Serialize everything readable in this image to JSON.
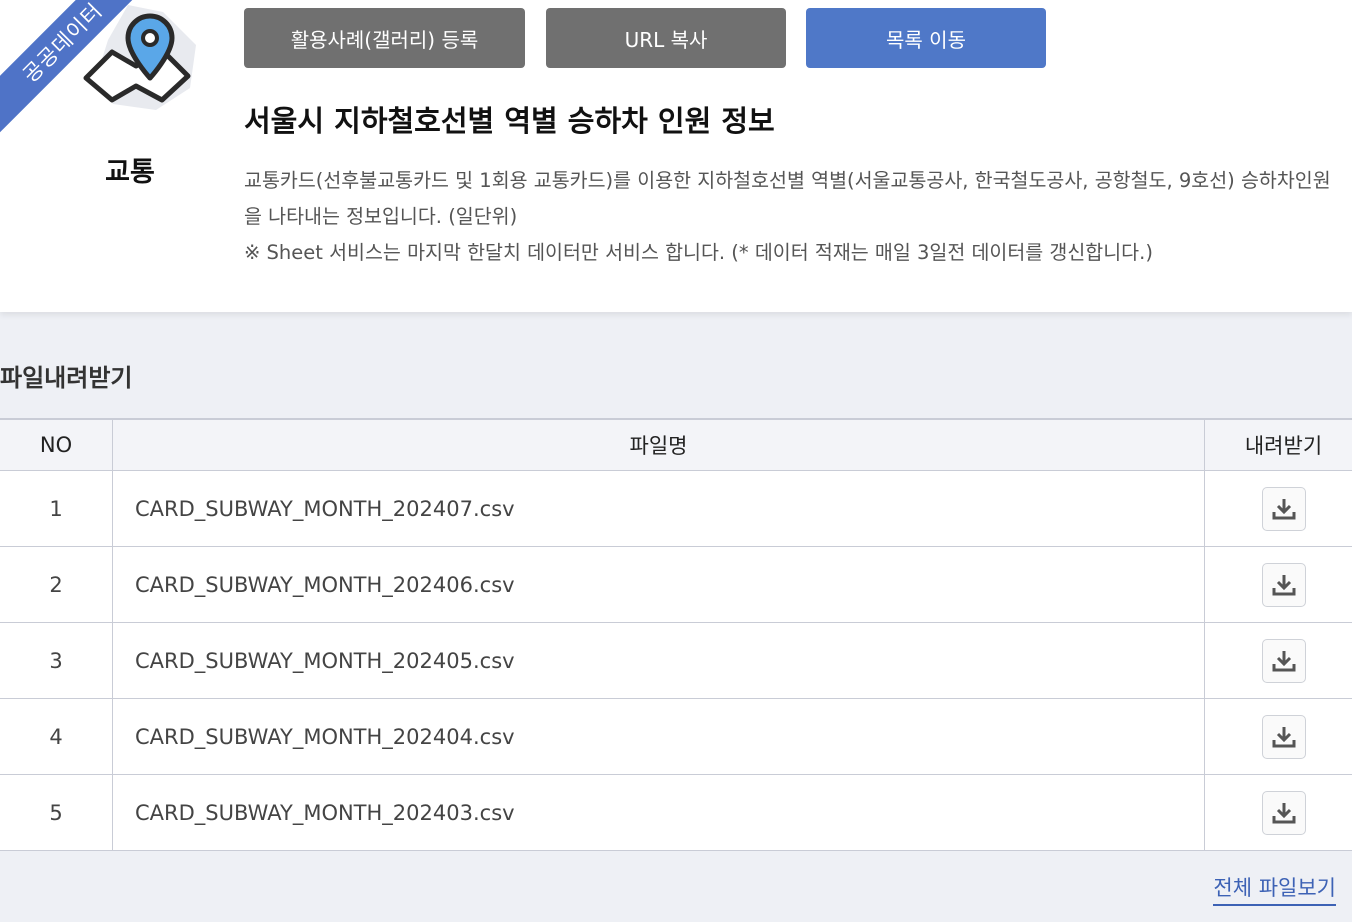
{
  "category": {
    "ribbon_text": "공공데이터",
    "label": "교통",
    "icon": "map-pin-icon"
  },
  "buttons": {
    "gallery": "활용사례(갤러리) 등록",
    "copy_url": "URL 복사",
    "list": "목록 이동"
  },
  "dataset": {
    "title": "서울시 지하철호선별 역별 승하차 인원 정보",
    "description_line1": "교통카드(선후불교통카드 및 1회용 교통카드)를 이용한 지하철호선별 역별(서울교통공사, 한국철도공사, 공항철도, 9호선) 승하차인원을 나타내는 정보입니다. (일단위)",
    "description_line2": "※ Sheet 서비스는 마지막 한달치 데이터만 서비스 합니다. (* 데이터 적재는 매일 3일전 데이터를 갱신합니다.)"
  },
  "downloads": {
    "section_title": "파일내려받기",
    "columns": {
      "no": "NO",
      "filename": "파일명",
      "download": "내려받기"
    },
    "rows": [
      {
        "no": "1",
        "filename": "CARD_SUBWAY_MONTH_202407.csv"
      },
      {
        "no": "2",
        "filename": "CARD_SUBWAY_MONTH_202406.csv"
      },
      {
        "no": "3",
        "filename": "CARD_SUBWAY_MONTH_202405.csv"
      },
      {
        "no": "4",
        "filename": "CARD_SUBWAY_MONTH_202404.csv"
      },
      {
        "no": "5",
        "filename": "CARD_SUBWAY_MONTH_202403.csv"
      }
    ],
    "view_all": "전체 파일보기"
  },
  "colors": {
    "accent": "#4f78c8",
    "gray_button": "#707070",
    "link": "#3d62b5"
  }
}
